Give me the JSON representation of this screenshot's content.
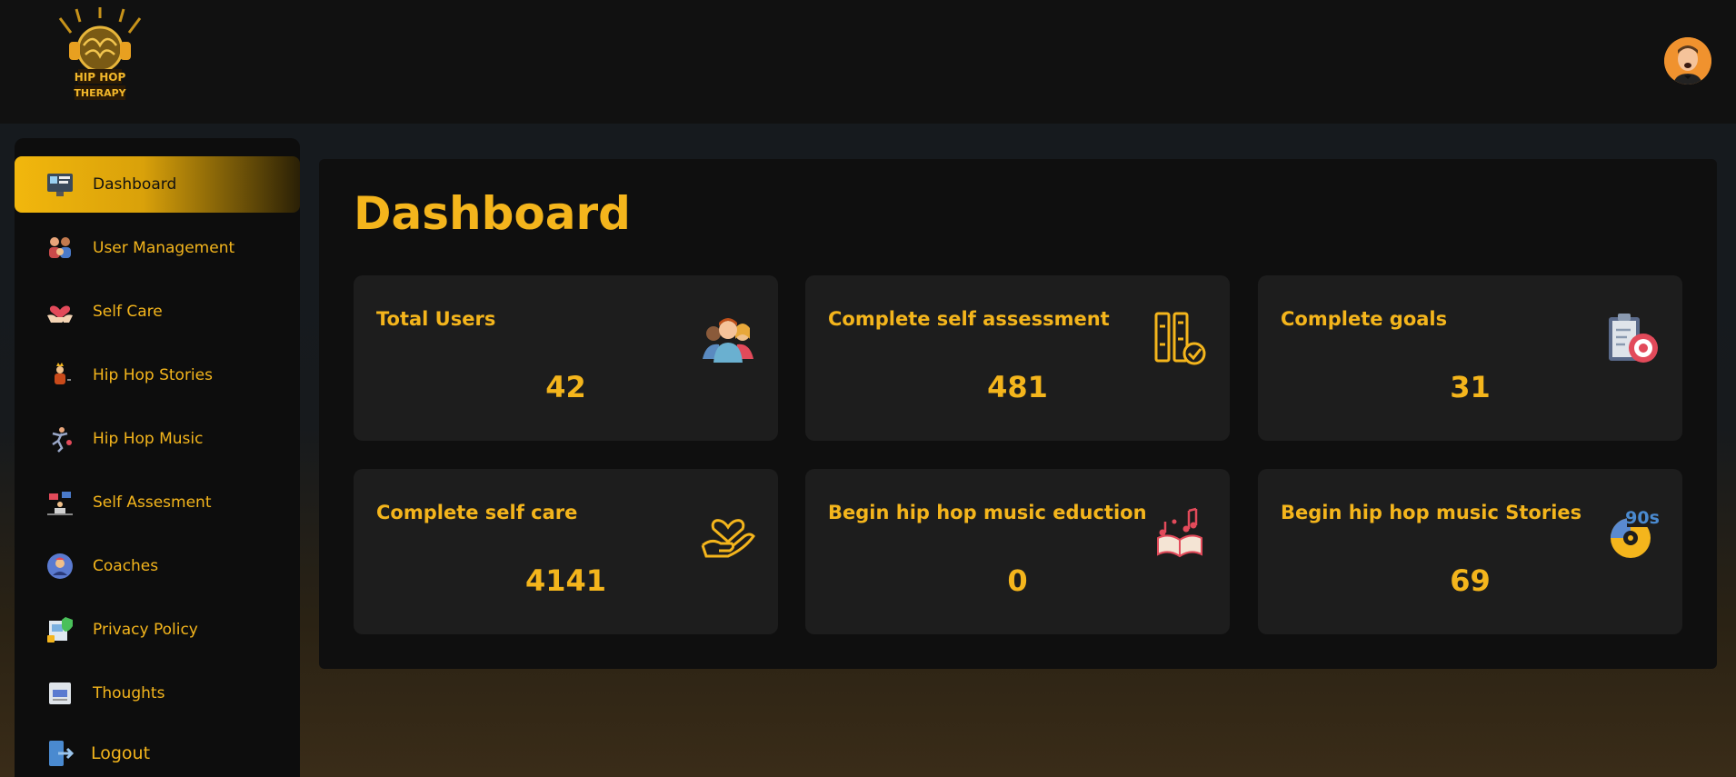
{
  "app": {
    "logo_text_top": "HIP HOP",
    "logo_text_bottom": "THERAPY",
    "accent_color": "#f4b51c",
    "background_color": "#111111"
  },
  "header": {
    "avatar_icon": "user-avatar-icon"
  },
  "sidebar": {
    "items": [
      {
        "label": "Dashboard",
        "icon": "dashboard-icon",
        "active": true
      },
      {
        "label": "User Management",
        "icon": "users-icon"
      },
      {
        "label": "Self Care",
        "icon": "heart-hand-icon"
      },
      {
        "label": "Hip Hop Stories",
        "icon": "stories-icon"
      },
      {
        "label": "Hip Hop Music",
        "icon": "dancer-icon"
      },
      {
        "label": "Self Assesment",
        "icon": "assessment-icon"
      },
      {
        "label": "Coaches",
        "icon": "coach-icon"
      },
      {
        "label": "Privacy Policy",
        "icon": "privacy-icon"
      },
      {
        "label": "Thoughts",
        "icon": "thoughts-icon"
      },
      {
        "label": "Logout",
        "icon": "logout-icon"
      }
    ]
  },
  "main": {
    "title": "Dashboard",
    "cards": [
      {
        "title": "Total Users",
        "value": "42",
        "icon": "users-group-icon"
      },
      {
        "title": "Complete self assessment",
        "value": "481",
        "icon": "checklist-icon"
      },
      {
        "title": "Complete goals",
        "value": "31",
        "icon": "goal-target-icon"
      },
      {
        "title": "Complete self care",
        "value": "4141",
        "icon": "heart-hand-icon"
      },
      {
        "title": "Begin hip hop music eduction",
        "value": "0",
        "icon": "music-book-icon"
      },
      {
        "title": "Begin hip hop music Stories",
        "value": "69",
        "icon": "record-90s-icon"
      }
    ]
  }
}
